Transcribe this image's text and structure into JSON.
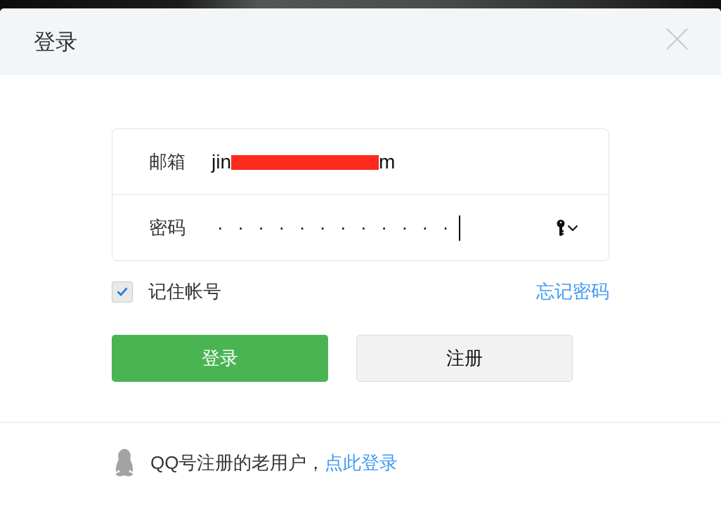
{
  "window": {
    "title": "登录"
  },
  "form": {
    "fields": [
      {
        "kind": "text",
        "label": "邮箱",
        "value_start": "jin",
        "value_end": "m",
        "redacted": true
      },
      {
        "kind": "password",
        "label": "密码",
        "value": "············",
        "focused": true
      }
    ]
  },
  "remember": {
    "label": "记住帐号",
    "checked": true
  },
  "forgot_link": "忘记密码",
  "buttons": [
    {
      "label": "登录",
      "kind": "primary"
    },
    {
      "label": "注册",
      "kind": "secondary"
    }
  ],
  "footer": {
    "text": "QQ号注册的老用户，",
    "link": "点此登录"
  }
}
